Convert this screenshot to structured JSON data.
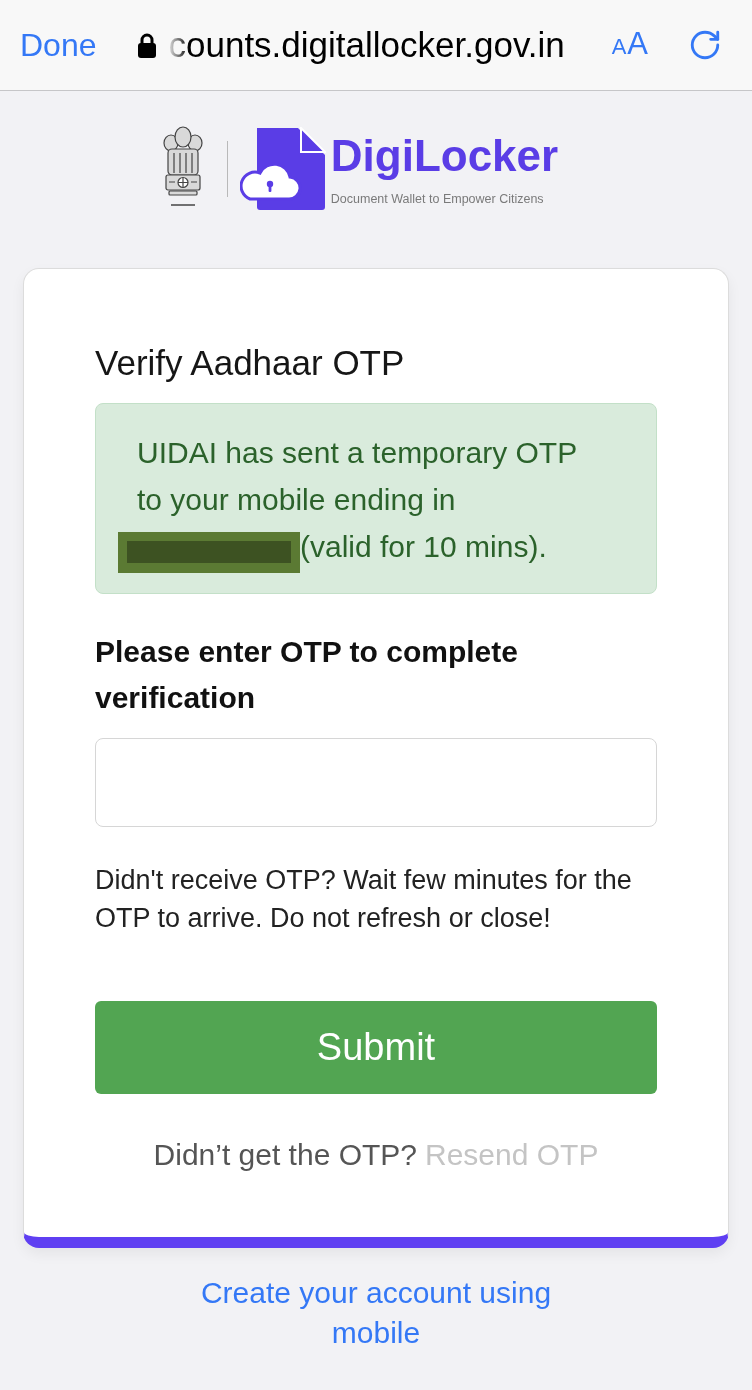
{
  "browser_bar": {
    "done": "Done",
    "secure": true,
    "url": "counts.digitallocker.gov.in",
    "text_size": [
      "A",
      "A"
    ]
  },
  "header": {
    "brand": "DigiLocker",
    "tagline": "Document Wallet to Empower Citizens"
  },
  "card": {
    "title": "Verify Aadhaar OTP",
    "alert": {
      "message": "UIDAI has sent a temporary OTP to your mobile ending in",
      "number_redacted": true,
      "validity": "(valid for 10 mins)."
    },
    "otp_field": {
      "label": "Please enter OTP to complete verification"
    },
    "help_text": "Didn't receive OTP? Wait few minutes for the OTP to arrive. Do not refresh or close!",
    "submit": "Submit",
    "resend": {
      "prompt": "Didn’t get the OTP?",
      "link": "Resend OTP",
      "disabled": true
    }
  },
  "footer_link": "Create your account using mobile"
}
